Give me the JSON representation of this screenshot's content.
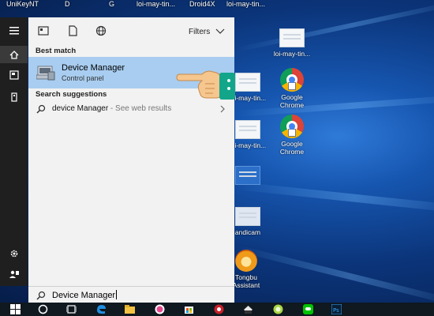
{
  "desktop": {
    "top_labels": [
      "UniKeyNT",
      "D",
      "G",
      "loi-may-tin...",
      "Droid4X",
      "loi-may-tin..."
    ],
    "icons": [
      {
        "label": "loi-may-tin...",
        "kind": "doc"
      },
      {
        "label": "Google Chrome",
        "kind": "chrome"
      },
      {
        "label": "loi-may-tin...",
        "kind": "doc"
      },
      {
        "label": "Google Chrome",
        "kind": "chrome"
      },
      {
        "label": "loi-may-tin...",
        "kind": "doc"
      },
      {
        "label": "andicam",
        "kind": "app"
      },
      {
        "label": "Tongbu Assistant",
        "kind": "tongbu"
      }
    ]
  },
  "start": {
    "filters_label": "Filters",
    "best_match_heading": "Best match",
    "best_match": {
      "title": "Device Manager",
      "subtitle": "Control panel"
    },
    "suggestions_heading": "Search suggestions",
    "suggestion": {
      "text": "device Manager",
      "hint": " - See web results"
    },
    "search_value": "Device Manager"
  },
  "rail": {
    "icons": [
      "hamburger-icon",
      "home-icon",
      "document-icon",
      "tower-icon",
      "gear-icon",
      "people-icon"
    ]
  },
  "taskbar": {
    "icons": [
      "windows-icon",
      "search-icon",
      "task-view-icon",
      "edge-icon",
      "explorer-icon",
      "itunes-icon",
      "store-icon",
      "app-red-icon",
      "app-box-icon",
      "app-green-icon",
      "line-icon",
      "photoshop-icon"
    ]
  },
  "colors": {
    "accent": "#a8cdf0",
    "panel": "#f2f2f2",
    "rail": "#1f1f1f",
    "taskbar": "#101820"
  }
}
